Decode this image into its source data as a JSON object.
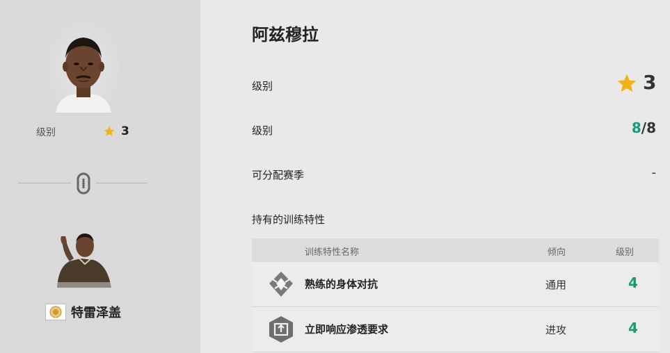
{
  "left": {
    "level_label": "级别",
    "level_value": "3",
    "player_name": "特雷泽盖"
  },
  "right": {
    "coach_name": "阿兹穆拉",
    "rows": [
      {
        "label": "级别",
        "value": "3"
      },
      {
        "label": "级别",
        "current": "8",
        "separator": "/",
        "max": "8"
      },
      {
        "label": "可分配赛季",
        "value": "-"
      },
      {
        "label": "持有的训练特性"
      }
    ],
    "table": {
      "headers": {
        "name": "训练特性名称",
        "tendency": "倾向",
        "level": "级别"
      },
      "traits": [
        {
          "icon": "physical-trait-icon",
          "name": "熟练的身体对抗",
          "tendency": "通用",
          "level": "4"
        },
        {
          "icon": "through-ball-trait-icon",
          "name": "立即响应渗透要求",
          "tendency": "进攻",
          "level": "4"
        }
      ]
    }
  },
  "colors": {
    "accent_green": "#1a9a78",
    "star_gold": "#f2b316",
    "left_bg": "#d9d9d9",
    "right_bg": "#e9e9e9"
  }
}
